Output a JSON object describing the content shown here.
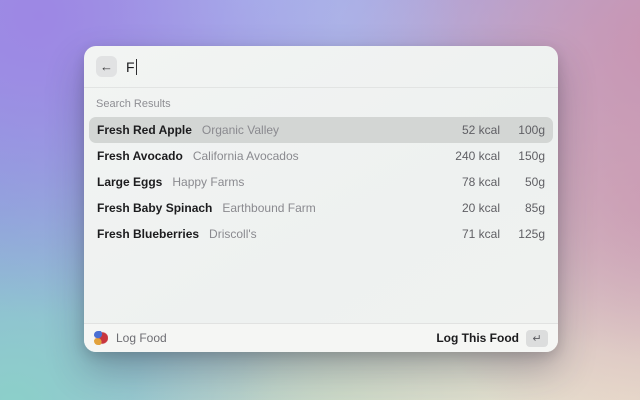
{
  "window": {
    "search": {
      "back_icon": "←",
      "query": "F"
    },
    "section_label": "Search Results",
    "results": [
      {
        "name": "Fresh Red Apple",
        "brand": "Organic Valley",
        "kcal": "52 kcal",
        "grams": "100g",
        "selected": true
      },
      {
        "name": "Fresh Avocado",
        "brand": "California Avocados",
        "kcal": "240 kcal",
        "grams": "150g",
        "selected": false
      },
      {
        "name": "Large Eggs",
        "brand": "Happy Farms",
        "kcal": "78 kcal",
        "grams": "50g",
        "selected": false
      },
      {
        "name": "Fresh Baby Spinach",
        "brand": "Earthbound Farm",
        "kcal": "20 kcal",
        "grams": "85g",
        "selected": false
      },
      {
        "name": "Fresh Blueberries",
        "brand": "Driscoll's",
        "kcal": "71 kcal",
        "grams": "125g",
        "selected": false
      }
    ],
    "footer": {
      "app_name": "Log Food",
      "action_label": "Log This Food",
      "action_key": "↵"
    }
  },
  "colors": {
    "selected_row": "#d3d6d4",
    "window_bg": "#f1f3f2",
    "primary_text": "#1c1c1e",
    "secondary_text": "#8a8a8f",
    "metric_text": "#5f5f64"
  }
}
